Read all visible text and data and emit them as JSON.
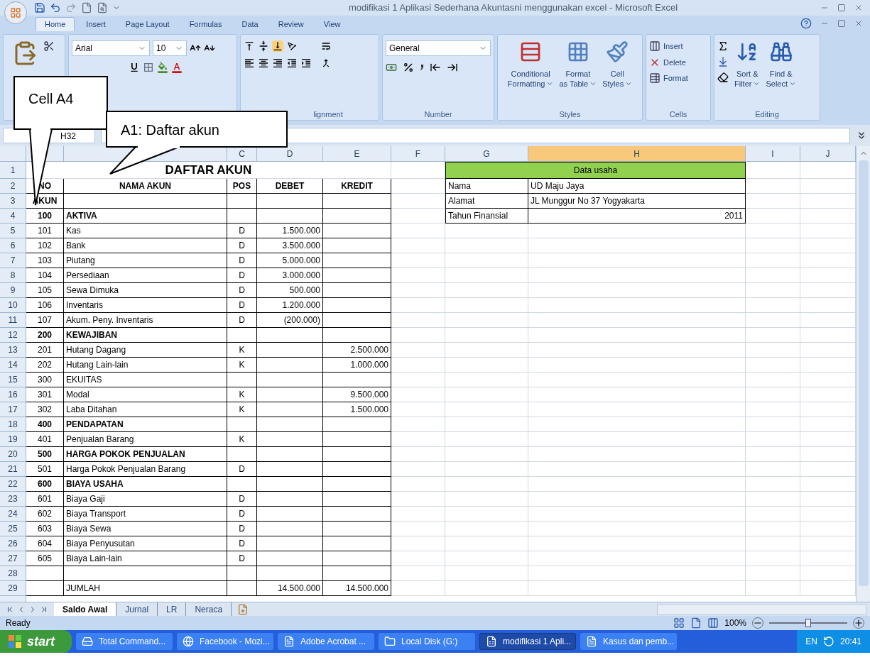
{
  "window": {
    "title": "modifikasi 1 Aplikasi Sederhana Akuntasni menggunakan excel - Microsoft Excel"
  },
  "ribbon": {
    "tabs": [
      {
        "label": "Home",
        "selected": true
      },
      {
        "label": "Insert",
        "selected": false
      },
      {
        "label": "Page Layout",
        "selected": false
      },
      {
        "label": "Formulas",
        "selected": false
      },
      {
        "label": "Data",
        "selected": false
      },
      {
        "label": "Review",
        "selected": false
      },
      {
        "label": "View",
        "selected": false
      }
    ],
    "font": {
      "name": "Arial",
      "size": "10"
    },
    "alignment": {
      "label": "lignment"
    },
    "number": {
      "format": "General",
      "label": "Number"
    },
    "styles": {
      "label": "Styles",
      "buttons": [
        {
          "line1": "Conditional",
          "line2": "Formatting"
        },
        {
          "line1": "Format",
          "line2": "as Table"
        },
        {
          "line1": "Cell",
          "line2": "Styles"
        }
      ]
    },
    "cells": {
      "label": "Cells",
      "buttons": [
        "Insert",
        "Delete",
        "Format"
      ]
    },
    "editing": {
      "label": "Editing",
      "buttons": [
        {
          "line1": "Sort &",
          "line2": "Filter"
        },
        {
          "line1": "Find &",
          "line2": "Select"
        }
      ]
    }
  },
  "formula_bar": {
    "name_box": "H32"
  },
  "sheet": {
    "columns": [
      {
        "selected": false
      },
      {
        "selected": false
      },
      {
        "label": "C",
        "selected": false
      },
      {
        "label": "D",
        "selected": false
      },
      {
        "label": "E",
        "selected": false
      },
      {
        "label": "F",
        "selected": false
      },
      {
        "label": "G",
        "selected": false
      },
      {
        "label": "H",
        "selected": true
      },
      {
        "label": "I",
        "selected": false
      },
      {
        "label": "J",
        "selected": false
      }
    ],
    "rows": [
      {
        "num": "1",
        "kind": "title",
        "title": "DAFTAR AKUN"
      },
      {
        "num": "2",
        "kind": "header",
        "no": "NO",
        "name": "NAMA AKUN",
        "pos": "POS",
        "debet": "DEBET",
        "kredit": "KREDIT"
      },
      {
        "num": "3",
        "kind": "header",
        "no": "AKUN"
      },
      {
        "num": "4",
        "kind": "account",
        "bold": true,
        "no": "100",
        "name": "AKTIVA"
      },
      {
        "num": "5",
        "kind": "account",
        "bold": false,
        "no": "101",
        "name": "Kas",
        "pos": "D",
        "debet": "1.500.000"
      },
      {
        "num": "6",
        "kind": "account",
        "bold": false,
        "no": "102",
        "name": "Bank",
        "pos": "D",
        "debet": "3.500.000"
      },
      {
        "num": "7",
        "kind": "account",
        "bold": false,
        "no": "103",
        "name": "Piutang",
        "pos": "D",
        "debet": "5.000.000"
      },
      {
        "num": "8",
        "kind": "account",
        "bold": false,
        "no": "104",
        "name": "Persediaan",
        "pos": "D",
        "debet": "3.000.000"
      },
      {
        "num": "9",
        "kind": "account",
        "bold": false,
        "no": "105",
        "name": "Sewa Dimuka",
        "pos": "D",
        "debet": "500.000"
      },
      {
        "num": "10",
        "kind": "account",
        "bold": false,
        "no": "106",
        "name": "Inventaris",
        "pos": "D",
        "debet": "1.200.000"
      },
      {
        "num": "11",
        "kind": "account",
        "bold": false,
        "no": "107",
        "name": "Akum. Peny. Inventaris",
        "pos": "D",
        "debet": "(200.000)"
      },
      {
        "num": "12",
        "kind": "account",
        "bold": true,
        "no": "200",
        "name": "KEWAJIBAN"
      },
      {
        "num": "13",
        "kind": "account",
        "bold": false,
        "no": "201",
        "name": "Hutang Dagang",
        "pos": "K",
        "kredit": "2.500.000"
      },
      {
        "num": "14",
        "kind": "account",
        "bold": false,
        "no": "202",
        "name": "Hutang Lain-lain",
        "pos": "K",
        "kredit": "1.000.000"
      },
      {
        "num": "15",
        "kind": "account",
        "bold": false,
        "no": "300",
        "name": "EKUITAS"
      },
      {
        "num": "16",
        "kind": "account",
        "bold": false,
        "no": "301",
        "name": "Modal",
        "pos": "K",
        "kredit": "9.500.000"
      },
      {
        "num": "17",
        "kind": "account",
        "bold": false,
        "no": "302",
        "name": "Laba Ditahan",
        "pos": "K",
        "kredit": "1.500.000"
      },
      {
        "num": "18",
        "kind": "account",
        "bold": true,
        "no": "400",
        "name": "PENDAPATAN"
      },
      {
        "num": "19",
        "kind": "account",
        "bold": false,
        "no": "401",
        "name": "Penjualan Barang",
        "pos": "K"
      },
      {
        "num": "20",
        "kind": "account",
        "bold": true,
        "no": "500",
        "name": "HARGA POKOK PENJUALAN"
      },
      {
        "num": "21",
        "kind": "account",
        "bold": false,
        "no": "501",
        "name": "Harga Pokok Penjualan Barang",
        "pos": "D"
      },
      {
        "num": "22",
        "kind": "account",
        "bold": true,
        "no": "600",
        "name": "BIAYA USAHA"
      },
      {
        "num": "23",
        "kind": "account",
        "bold": false,
        "no": "601",
        "name": "Biaya Gaji",
        "pos": "D"
      },
      {
        "num": "24",
        "kind": "account",
        "bold": false,
        "no": "602",
        "name": "Biaya Transport",
        "pos": "D"
      },
      {
        "num": "25",
        "kind": "account",
        "bold": false,
        "no": "603",
        "name": "Biaya Sewa",
        "pos": "D"
      },
      {
        "num": "26",
        "kind": "account",
        "bold": false,
        "no": "604",
        "name": "Biaya Penyusutan",
        "pos": "D"
      },
      {
        "num": "27",
        "kind": "account",
        "bold": false,
        "no": "605",
        "name": "Biaya Lain-lain",
        "pos": "D"
      },
      {
        "num": "28",
        "kind": "account"
      },
      {
        "num": "29",
        "kind": "account",
        "bold": false,
        "name": "JUMLAH",
        "debet": "14.500.000",
        "kredit": "14.500.000"
      }
    ],
    "data_usaha": {
      "title": "Data usaha",
      "color": "#92d050",
      "fields": [
        {
          "label": "Nama",
          "value": "UD Maju Jaya",
          "kind": "text"
        },
        {
          "label": "Alamat",
          "value": "JL Munggur No 37 Yogyakarta",
          "kind": "text"
        },
        {
          "label": "Tahun Finansial",
          "value": "2011",
          "kind": "number"
        }
      ]
    }
  },
  "callouts": [
    {
      "text": "Cell A4"
    },
    {
      "text": "A1: Daftar akun"
    }
  ],
  "sheet_tabs": [
    {
      "label": "Saldo Awal",
      "selected": true
    },
    {
      "label": "Jurnal",
      "selected": false
    },
    {
      "label": "LR",
      "selected": false
    },
    {
      "label": "Neraca",
      "selected": false
    }
  ],
  "status_bar": {
    "status": "Ready",
    "zoom": "100%",
    "zoom_level": {
      "level": 0.5
    }
  },
  "taskbar": {
    "start": "start",
    "items": [
      {
        "label": "Total Command...",
        "selected": false
      },
      {
        "label": "Facebook - Mozi...",
        "selected": false
      },
      {
        "label": "Adobe Acrobat ...",
        "selected": false
      },
      {
        "label": "Local Disk (G:)",
        "selected": false
      },
      {
        "label": "modifikasi 1 Apli...",
        "selected": true
      },
      {
        "label": "Kasus dan pemb...",
        "selected": false
      }
    ],
    "language": "EN",
    "clock": "20:41"
  }
}
